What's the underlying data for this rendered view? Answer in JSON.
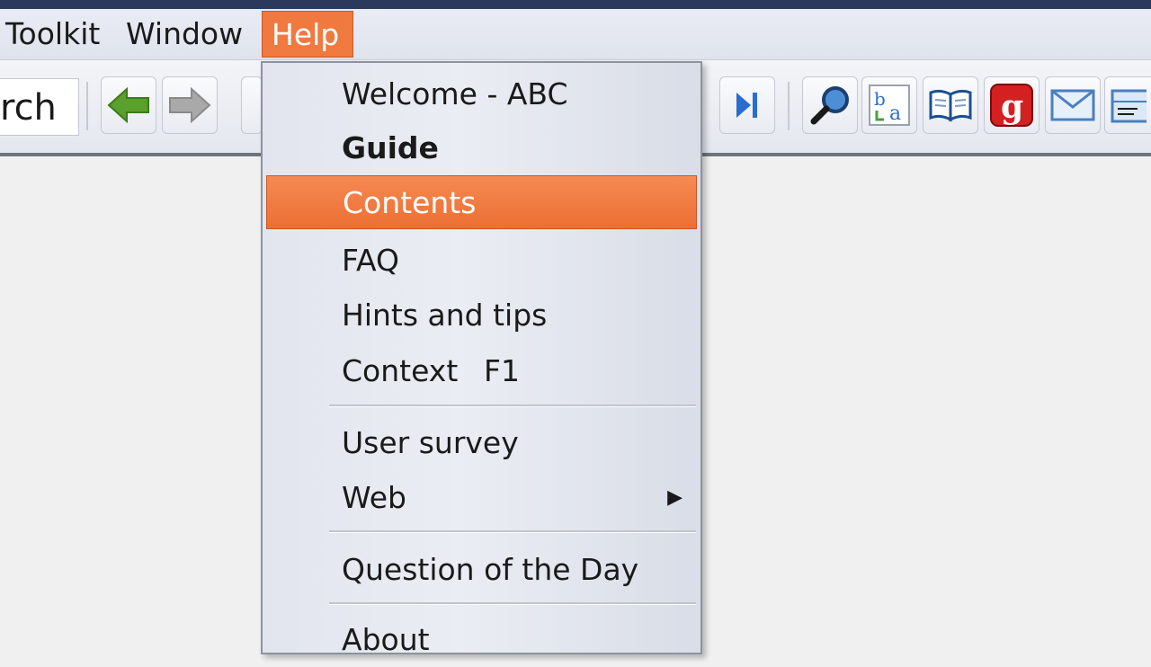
{
  "menubar": {
    "items": [
      {
        "label": "Toolkit"
      },
      {
        "label": "Window"
      },
      {
        "label": "Help"
      }
    ]
  },
  "toolbar": {
    "search_fragment": "rch",
    "icons": [
      "back-arrow-icon",
      "forward-arrow-icon",
      "last-page-icon",
      "magnifier-icon",
      "ba-translate-icon",
      "book-icon",
      "g-red-icon",
      "mail-icon",
      "table-icon"
    ]
  },
  "help_menu": {
    "items": [
      {
        "label": "Welcome - ABC"
      },
      {
        "label": "Guide"
      },
      {
        "label": "Contents"
      },
      {
        "label": "FAQ"
      },
      {
        "label": "Hints and tips"
      },
      {
        "label": "Context",
        "shortcut": "F1"
      },
      {
        "label": "User survey"
      },
      {
        "label": "Web",
        "submenu_indicator": "▶"
      },
      {
        "label": "Question of the Day"
      },
      {
        "label": "About"
      }
    ]
  },
  "colors": {
    "accent": "#f0793f",
    "highlight": "#ec6f33",
    "titlebar": "#2b3a5c"
  }
}
